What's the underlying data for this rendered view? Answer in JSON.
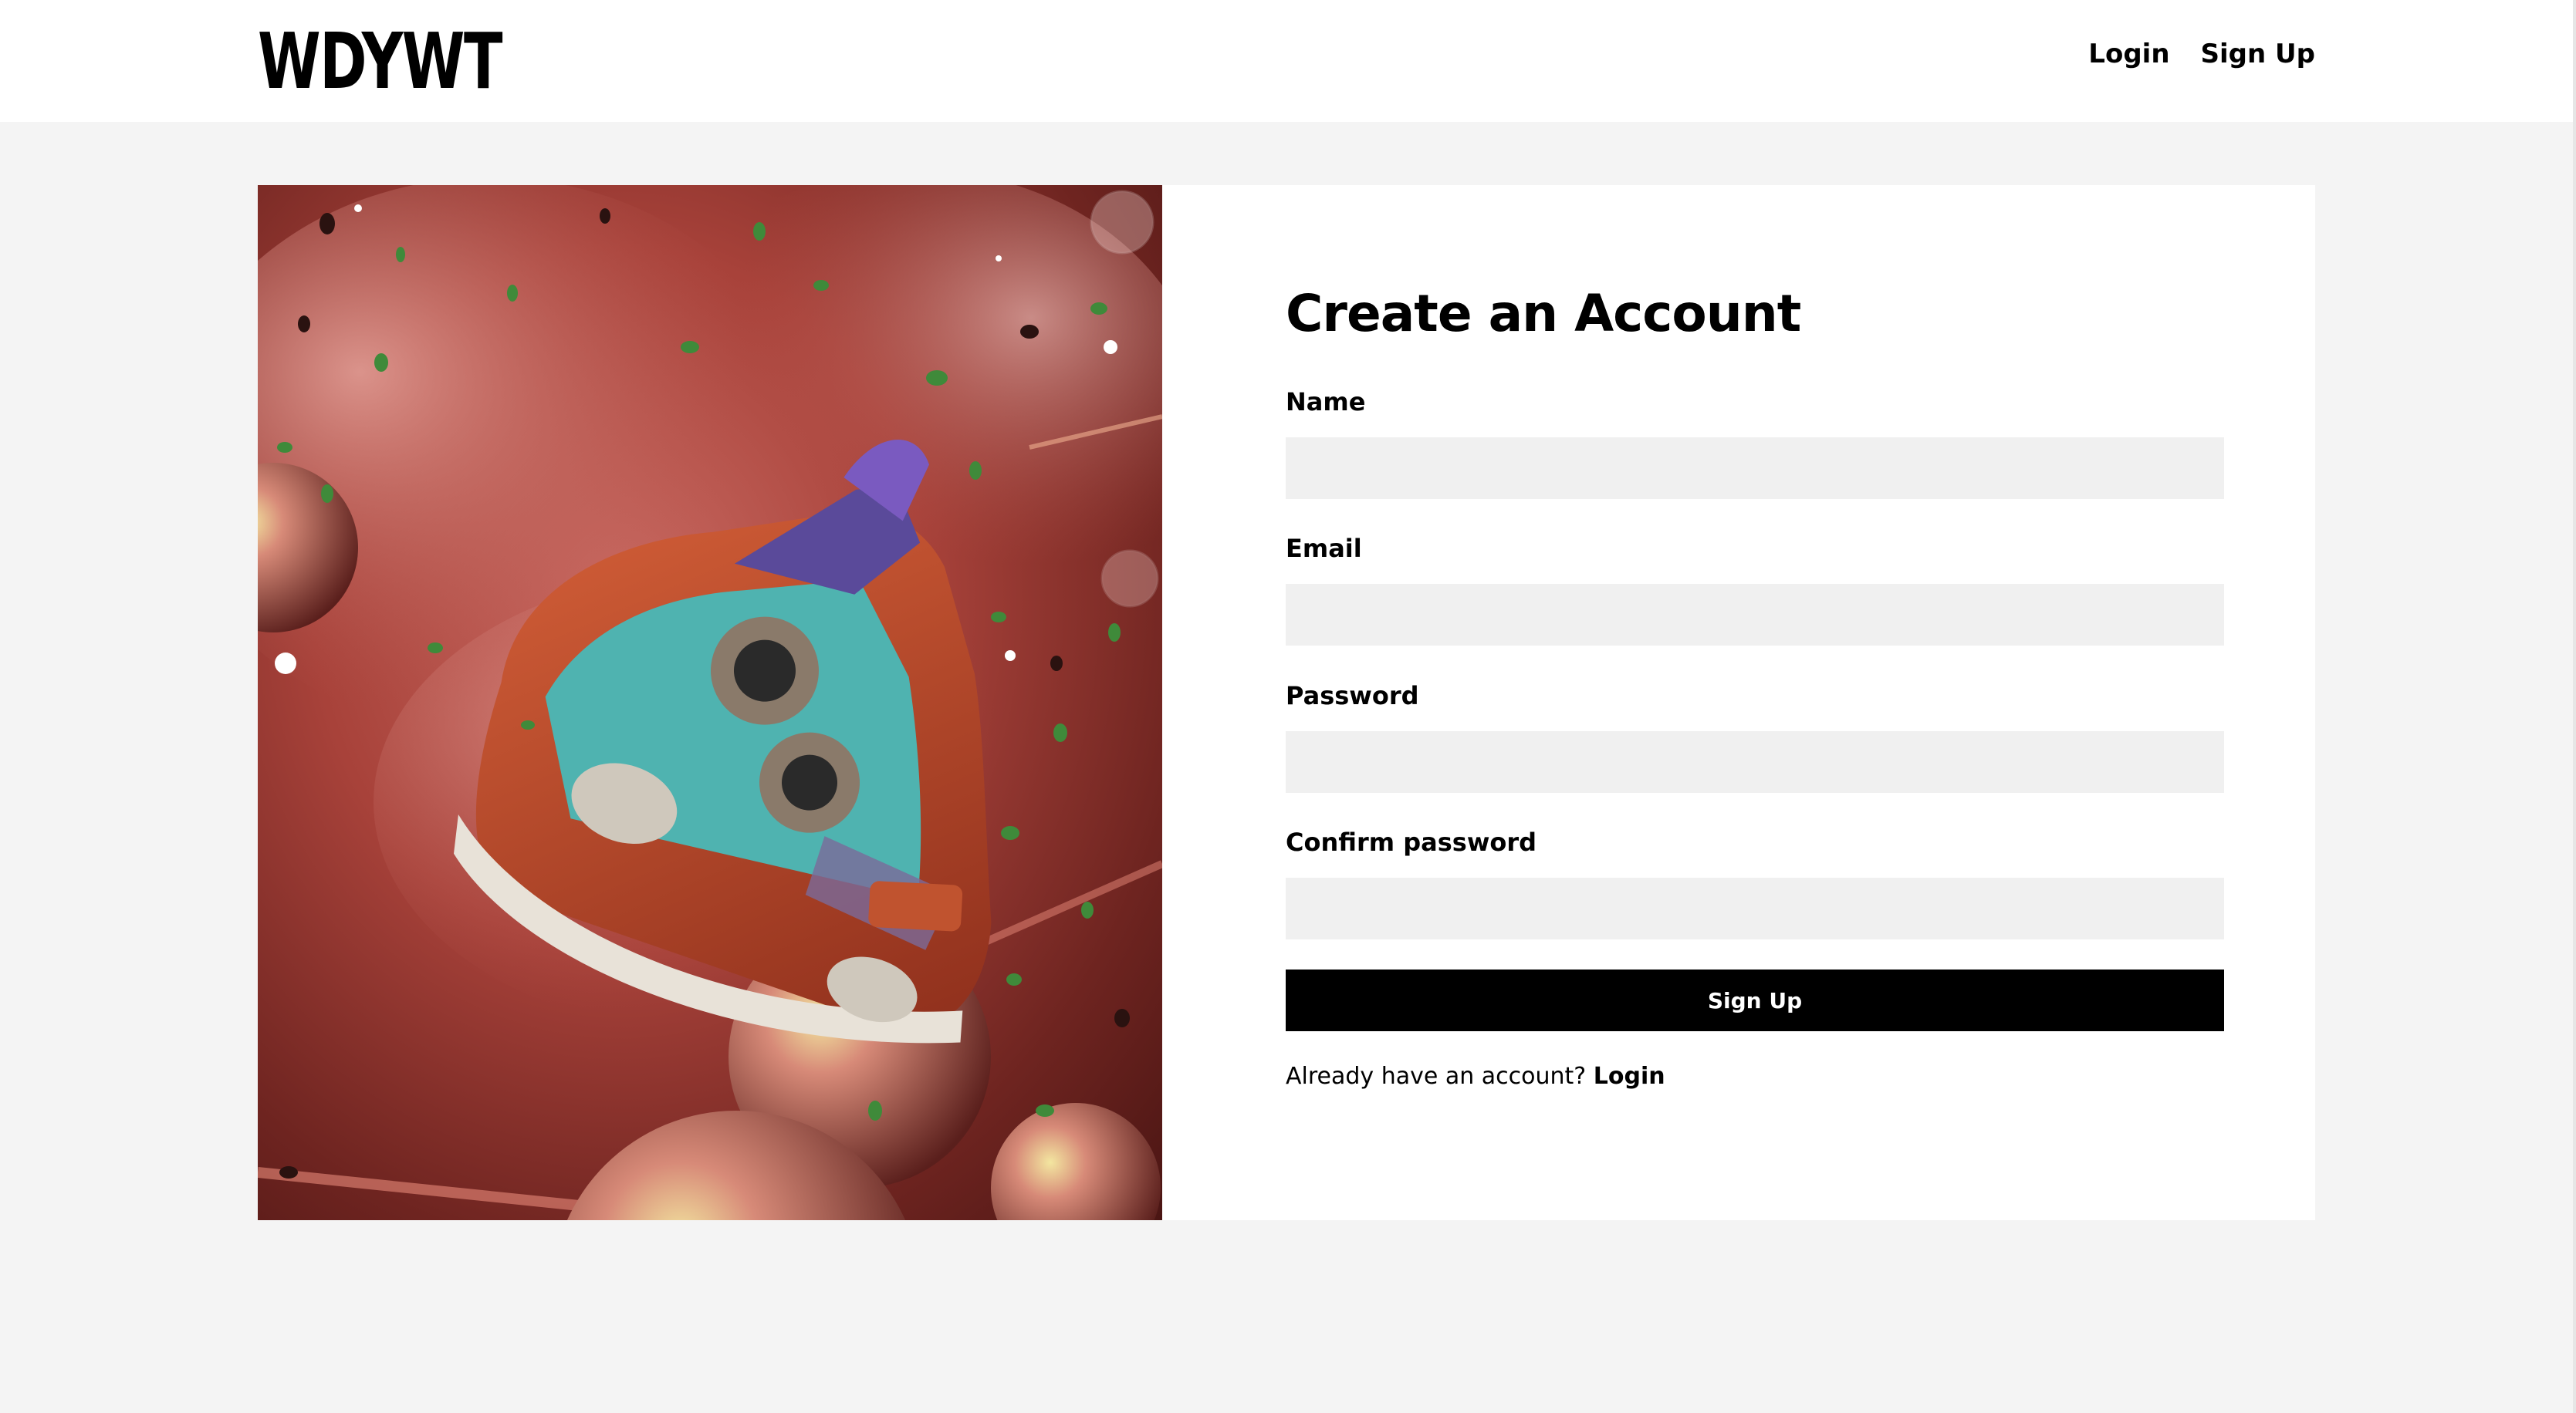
{
  "header": {
    "logo": "WDYWT",
    "links": [
      {
        "label": "Login"
      },
      {
        "label": "Sign Up"
      }
    ]
  },
  "form": {
    "title": "Create an Account",
    "fields": [
      {
        "label": "Name",
        "value": "",
        "placeholder": ""
      },
      {
        "label": "Email",
        "value": "",
        "placeholder": ""
      },
      {
        "label": "Password",
        "value": "",
        "placeholder": ""
      },
      {
        "label": "Confirm password",
        "value": "",
        "placeholder": ""
      }
    ],
    "submit_label": "Sign Up",
    "footer_text": "Already have an account?",
    "footer_link": "Login"
  },
  "hero": {
    "icon": "sneaker-photo",
    "colors": {
      "smoke": "#b5524a",
      "shoe_orange": "#c4532f",
      "shoe_teal": "#4fb3b0",
      "shoe_purple": "#5a4a9a",
      "confetti": "#3f8a3a"
    }
  },
  "colors": {
    "background": "#f4f4f4",
    "card": "#ffffff",
    "input": "#f0f0f0",
    "button": "#000000",
    "button_text": "#ffffff"
  }
}
